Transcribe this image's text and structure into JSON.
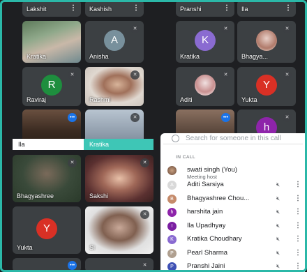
{
  "top_row": [
    "Lakshit",
    "Kashish",
    "Pranshi",
    "Ila"
  ],
  "tiles": {
    "kratika_video": "Kratika",
    "anisha": {
      "name": "Anisha",
      "initial": "A"
    },
    "kratika_avatar": {
      "name": "Kratika",
      "initial": "K"
    },
    "bhagya": "Bhagya...",
    "raviraj": {
      "name": "Raviraj",
      "initial": "R"
    },
    "rashmi": "Rashmi",
    "aditi": "Aditi",
    "yukta_top": {
      "name": "Yukta",
      "initial": "Y"
    },
    "ila_video": "Ila",
    "kratika_small": "Kratika",
    "h_tile": {
      "initial": "h"
    },
    "bhagyashree_video": "Bhagyashree",
    "sakshi": "Sakshi",
    "yukta_bottom": {
      "name": "Yukta",
      "initial": "Y"
    },
    "si_video": "Si"
  },
  "people_panel": {
    "search_placeholder": "Search for someone in this call",
    "section_label": "IN CALL",
    "host": {
      "name": "swati singh (You)",
      "role": "Meeting host"
    },
    "participants": [
      {
        "name": "Aditi Sarsiya",
        "initial": "A",
        "color": "#d9d9d9"
      },
      {
        "name": "Bhagyashree Chou...",
        "initial": "B",
        "color": "#c58b6b"
      },
      {
        "name": "harshita jain",
        "initial": "h",
        "color": "#8e24aa"
      },
      {
        "name": "Ila Upadhyay",
        "initial": "I",
        "color": "#7b1fa2"
      },
      {
        "name": "Kratika Choudhary",
        "initial": "K",
        "color": "#8a6bd1"
      },
      {
        "name": "Pearl Sharma",
        "initial": "P",
        "color": "#b0a090"
      },
      {
        "name": "Pranshi Jaini",
        "initial": "P",
        "color": "#3f51b5"
      }
    ]
  },
  "colors": {
    "accent": "#2bb8a8",
    "tile_bg": "#3c4043",
    "avatar_purple": "#8a6bd1",
    "avatar_red": "#d93025",
    "avatar_green": "#1e8e3e"
  }
}
